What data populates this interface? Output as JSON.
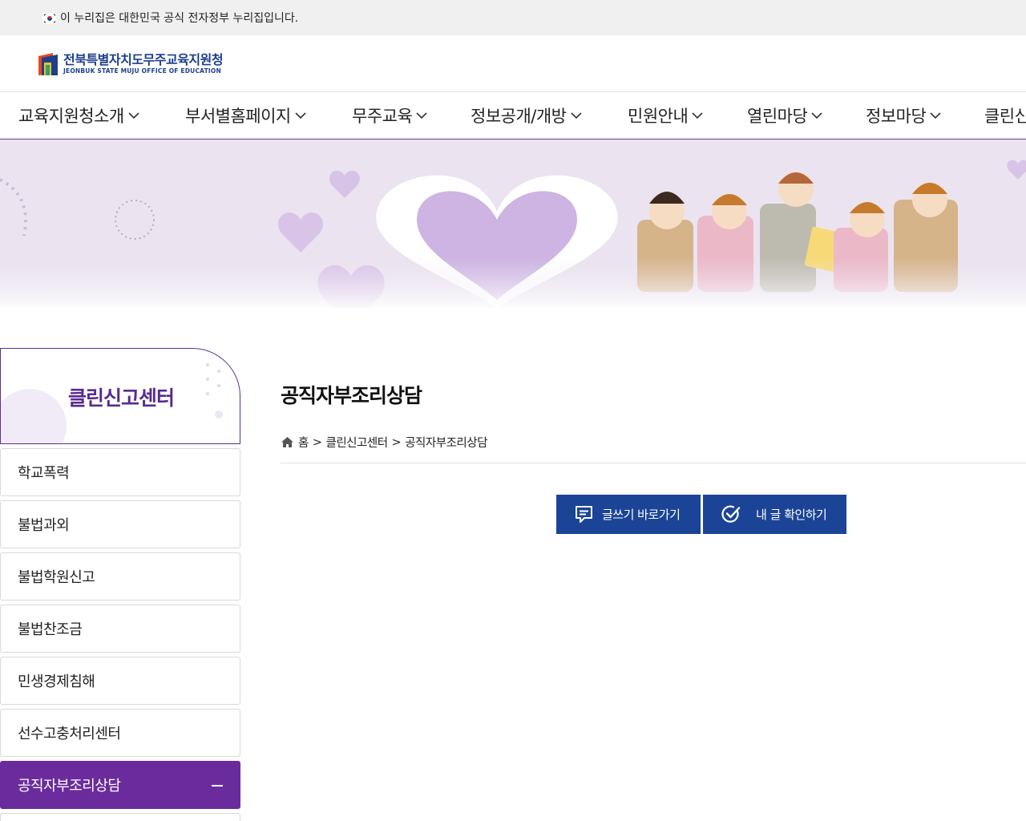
{
  "gov_banner": {
    "text": "이 누리집은 대한민국 공식 전자정부 누리집입니다."
  },
  "logo": {
    "name_ko": "전북특별자치도무주교육지원청",
    "name_en": "JEONBUK STATE MUJU OFFICE OF EDUCATION"
  },
  "gnb": {
    "items": [
      {
        "label": "교육지원청소개"
      },
      {
        "label": "부서별홈페이지"
      },
      {
        "label": "무주교육"
      },
      {
        "label": "정보공개/개방"
      },
      {
        "label": "민원안내"
      },
      {
        "label": "열린마당"
      },
      {
        "label": "정보마당"
      },
      {
        "label": "클린신"
      }
    ]
  },
  "lnb": {
    "title": "클린신고센터",
    "items": [
      {
        "label": "학교폭력"
      },
      {
        "label": "불법과외"
      },
      {
        "label": "불법학원신고"
      },
      {
        "label": "불법찬조금"
      },
      {
        "label": "민생경제침해"
      },
      {
        "label": "선수고충처리센터"
      },
      {
        "label": "공직자부조리상담"
      }
    ]
  },
  "content": {
    "title": "공직자부조리상담",
    "breadcrumb": {
      "home": "홈",
      "sep": ">",
      "level1": "클린신고센터",
      "level2": "공직자부조리상담"
    },
    "buttons": {
      "write": "글쓰기 바로가기",
      "check": "내 글 확인하기"
    }
  },
  "colors": {
    "accent_purple": "#6a2c9c",
    "button_blue": "#1b4497",
    "logo_blue": "#1d3f8e"
  }
}
